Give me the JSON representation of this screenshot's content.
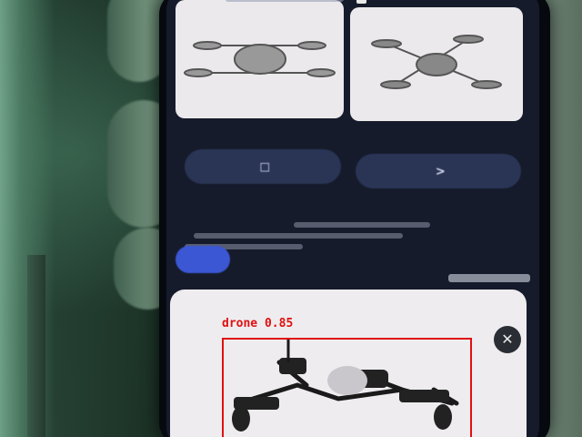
{
  "detection": {
    "class_label": "drone",
    "confidence": "0.85",
    "box_color": "#e01010"
  },
  "phone_screen": {
    "status_text": "",
    "button_left_label": "",
    "button_right_label": "",
    "small_button_label": "",
    "section_title": "",
    "description_lines": [
      "",
      "",
      ""
    ],
    "accent_color": "#3b57d4"
  },
  "icons": {
    "top_checkbox": "checkbox-icon",
    "close_icon": "close-circle-icon",
    "drone_icon": "drone-icon"
  }
}
